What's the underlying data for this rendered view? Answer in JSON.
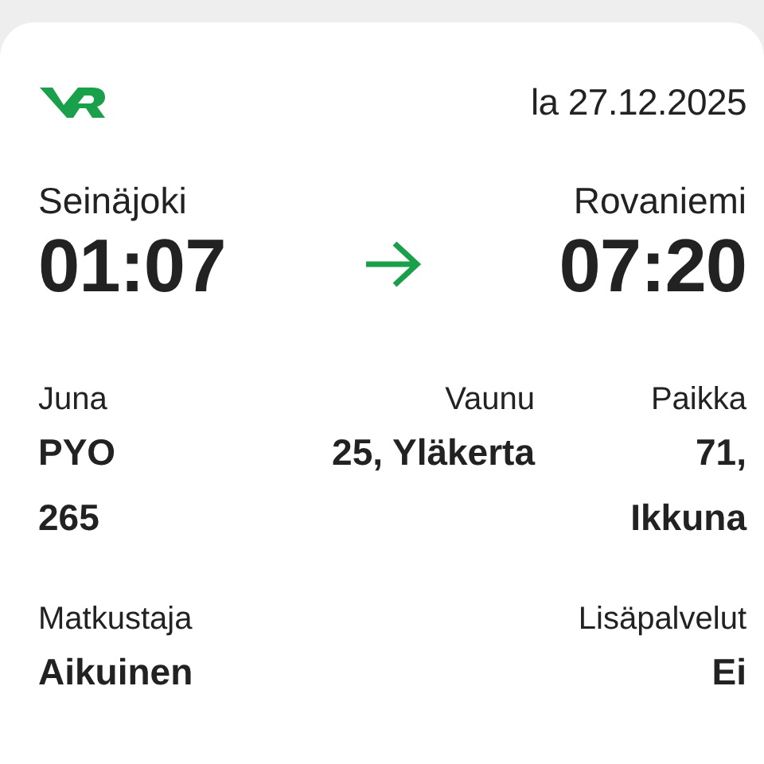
{
  "date": "la 27.12.2025",
  "route": {
    "from": {
      "station": "Seinäjoki",
      "time": "01:07"
    },
    "to": {
      "station": "Rovaniemi",
      "time": "07:20"
    }
  },
  "details": [
    {
      "label": "Juna",
      "value": "PYO 265"
    },
    {
      "label": "Vaunu",
      "value": "25, Yläkerta"
    },
    {
      "label": "Paikka",
      "value": "71, Ikkuna"
    }
  ],
  "passenger": [
    {
      "label": "Matkustaja",
      "value": "Aikuinen"
    },
    {
      "label": "Lisäpalvelut",
      "value": "Ei"
    }
  ]
}
